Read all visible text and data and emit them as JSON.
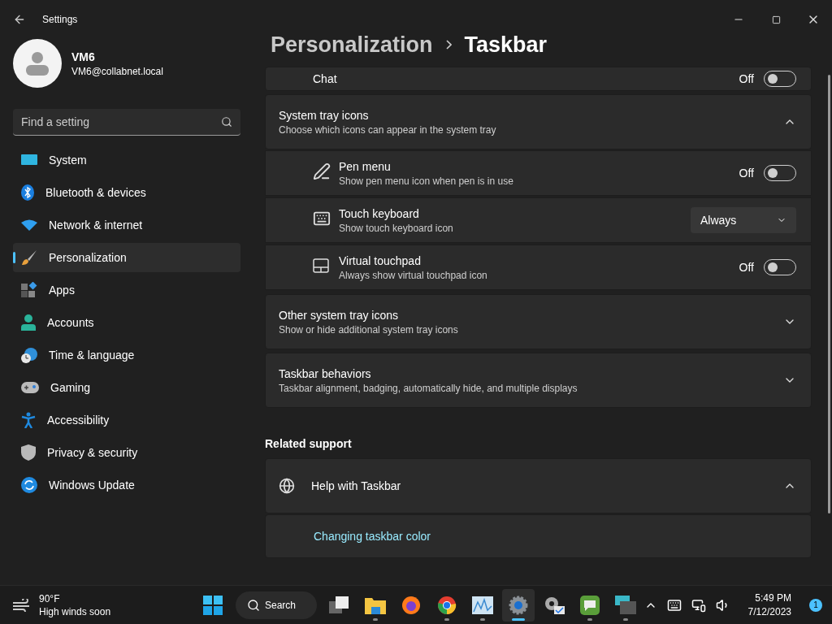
{
  "window": {
    "title": "Settings"
  },
  "user": {
    "name": "VM6",
    "email": "VM6@collabnet.local"
  },
  "search": {
    "placeholder": "Find a setting"
  },
  "nav": [
    {
      "label": "System",
      "selected": false
    },
    {
      "label": "Bluetooth & devices",
      "selected": false
    },
    {
      "label": "Network & internet",
      "selected": false
    },
    {
      "label": "Personalization",
      "selected": true
    },
    {
      "label": "Apps",
      "selected": false
    },
    {
      "label": "Accounts",
      "selected": false
    },
    {
      "label": "Time & language",
      "selected": false
    },
    {
      "label": "Gaming",
      "selected": false
    },
    {
      "label": "Accessibility",
      "selected": false
    },
    {
      "label": "Privacy & security",
      "selected": false
    },
    {
      "label": "Windows Update",
      "selected": false
    }
  ],
  "breadcrumb": [
    "Personalization",
    "Taskbar"
  ],
  "partial_row": {
    "label": "Chat",
    "state_label": "Off",
    "on": false
  },
  "sections": [
    {
      "title": "System tray icons",
      "subtitle": "Choose which icons can appear in the system tray",
      "expanded": true,
      "items": [
        {
          "kind": "toggle",
          "label": "Pen menu",
          "description": "Show pen menu icon when pen is in use",
          "state_label": "Off",
          "on": false
        },
        {
          "kind": "dropdown",
          "label": "Touch keyboard",
          "description": "Show touch keyboard icon",
          "value": "Always"
        },
        {
          "kind": "toggle",
          "label": "Virtual touchpad",
          "description": "Always show virtual touchpad icon",
          "state_label": "Off",
          "on": false
        }
      ]
    },
    {
      "title": "Other system tray icons",
      "subtitle": "Show or hide additional system tray icons",
      "expanded": false
    },
    {
      "title": "Taskbar behaviors",
      "subtitle": "Taskbar alignment, badging, automatically hide, and multiple displays",
      "expanded": false
    }
  ],
  "related": {
    "heading": "Related support",
    "title": "Help with Taskbar",
    "expanded": true,
    "links": [
      "Changing taskbar color"
    ]
  },
  "taskbar": {
    "weather": {
      "temp": "90°F",
      "text": "High winds soon"
    },
    "search_label": "Search",
    "apps": [
      {
        "running": false,
        "active": false
      },
      {
        "running": true,
        "active": false
      },
      {
        "running": false,
        "active": false
      },
      {
        "running": true,
        "active": false
      },
      {
        "running": true,
        "active": false
      },
      {
        "running": true,
        "active": true
      },
      {
        "running": false,
        "active": false
      },
      {
        "running": true,
        "active": false
      },
      {
        "running": true,
        "active": false
      }
    ],
    "time": "5:49 PM",
    "date": "7/12/2023",
    "notifications": "1"
  }
}
